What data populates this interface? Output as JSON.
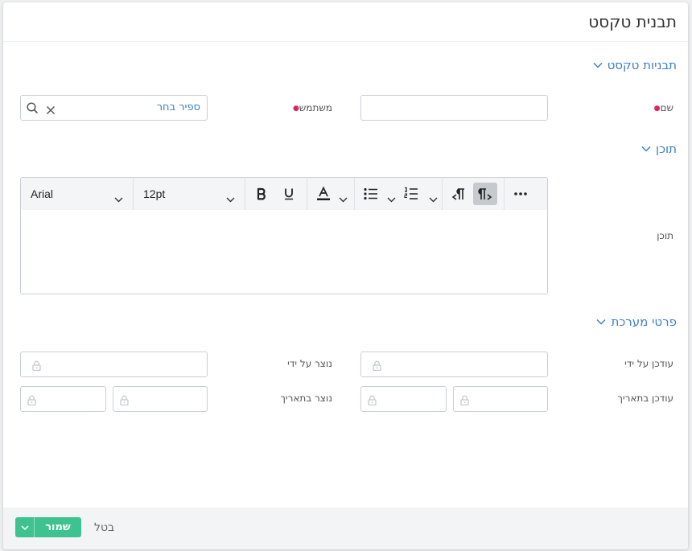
{
  "dialog": {
    "title": "תבנית טקסט"
  },
  "sections": {
    "templates": {
      "title": "תבניות טקסט"
    },
    "content": {
      "title": "תוכן"
    },
    "system": {
      "title": "פרטי מערכת"
    }
  },
  "fields": {
    "name": {
      "label": "שם",
      "value": ""
    },
    "user": {
      "label": "משתמש",
      "value": "",
      "action": "ספיר בחר"
    },
    "content": {
      "label": "תוכן"
    },
    "updated_by": {
      "label": "עודכן על ידי"
    },
    "created_by": {
      "label": "נוצר על ידי"
    },
    "updated_on": {
      "label": "עודכן בתאריך"
    },
    "created_on": {
      "label": "נוצר בתאריך"
    }
  },
  "editor": {
    "font": "Arial",
    "size": "12pt",
    "text": ""
  },
  "footer": {
    "save_label": "שמור",
    "cancel_label": "בטל"
  },
  "colors": {
    "accent": "#3d7fc4",
    "save": "#3ec28f",
    "required": "#e0245e"
  }
}
